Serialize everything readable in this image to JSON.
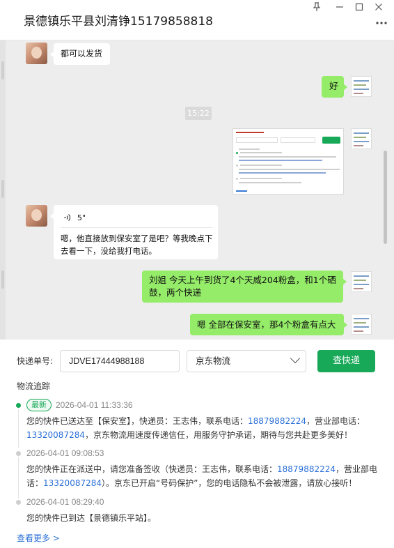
{
  "window": {
    "title": "景德镇乐平县刘清铮15179858818",
    "pin_icon": "pin-icon",
    "minimize_icon": "minimize-icon",
    "maximize_icon": "maximize-icon",
    "close_icon": "close-icon",
    "more_icon": "more-options-icon"
  },
  "chat": {
    "background": "#ededed",
    "incoming_bubble_color": "#ffffff",
    "outgoing_bubble_color": "#95ec69",
    "messages": [
      {
        "side": "left",
        "type": "text",
        "text": "都可以发货"
      },
      {
        "side": "right",
        "type": "text",
        "text": "好"
      },
      {
        "type": "time",
        "text": "15:22"
      },
      {
        "side": "right",
        "type": "image",
        "description": "express-tracking-screenshot"
      },
      {
        "side": "left",
        "type": "voice",
        "duration": "5\"",
        "transcript": "嗯，他直接放到保安室了是吧？等我晚点下去看一下，没给我打电话。"
      },
      {
        "side": "right",
        "type": "text",
        "text": "刘姐 今天上午到货了4个天威204粉盒，和1个硒鼓，两个快递"
      },
      {
        "side": "right",
        "type": "text",
        "text": "嗯 全部在保安室，那4个粉盒有点大"
      }
    ]
  },
  "express": {
    "tracking_label": "快递单号:",
    "tracking_value": "JDVE17444988188",
    "carrier_selected": "京东物流",
    "query_button": "查快递",
    "accent_color": "#17a858",
    "section_title": "物流追踪",
    "latest_badge": "最新",
    "events": [
      {
        "time": "2026-04-01 11:33:36",
        "parts": [
          "您的快件已送达至【保安室】，快递员：王志伟，联系电话：",
          "18879882224",
          "，营业部电话：",
          "13320087284",
          "，京东物流用速度传递信任，用服务守护承诺，期待与您共赴更多美好！"
        ]
      },
      {
        "time": "2026-04-01 09:08:53",
        "parts": [
          "您的快件正在派送中，请您准备签收（快递员：王志伟，联系电话：",
          "18879882224",
          "，营业部电话：",
          "13320087284",
          "）。京东已开启“号码保护”，您的电话隐私不会被泄露，请放心接听！"
        ]
      },
      {
        "time": "2026-04-01 08:29:40",
        "parts": [
          "您的快件已到达【景德镇乐平站】。"
        ]
      }
    ],
    "see_more": "查看更多 >"
  }
}
